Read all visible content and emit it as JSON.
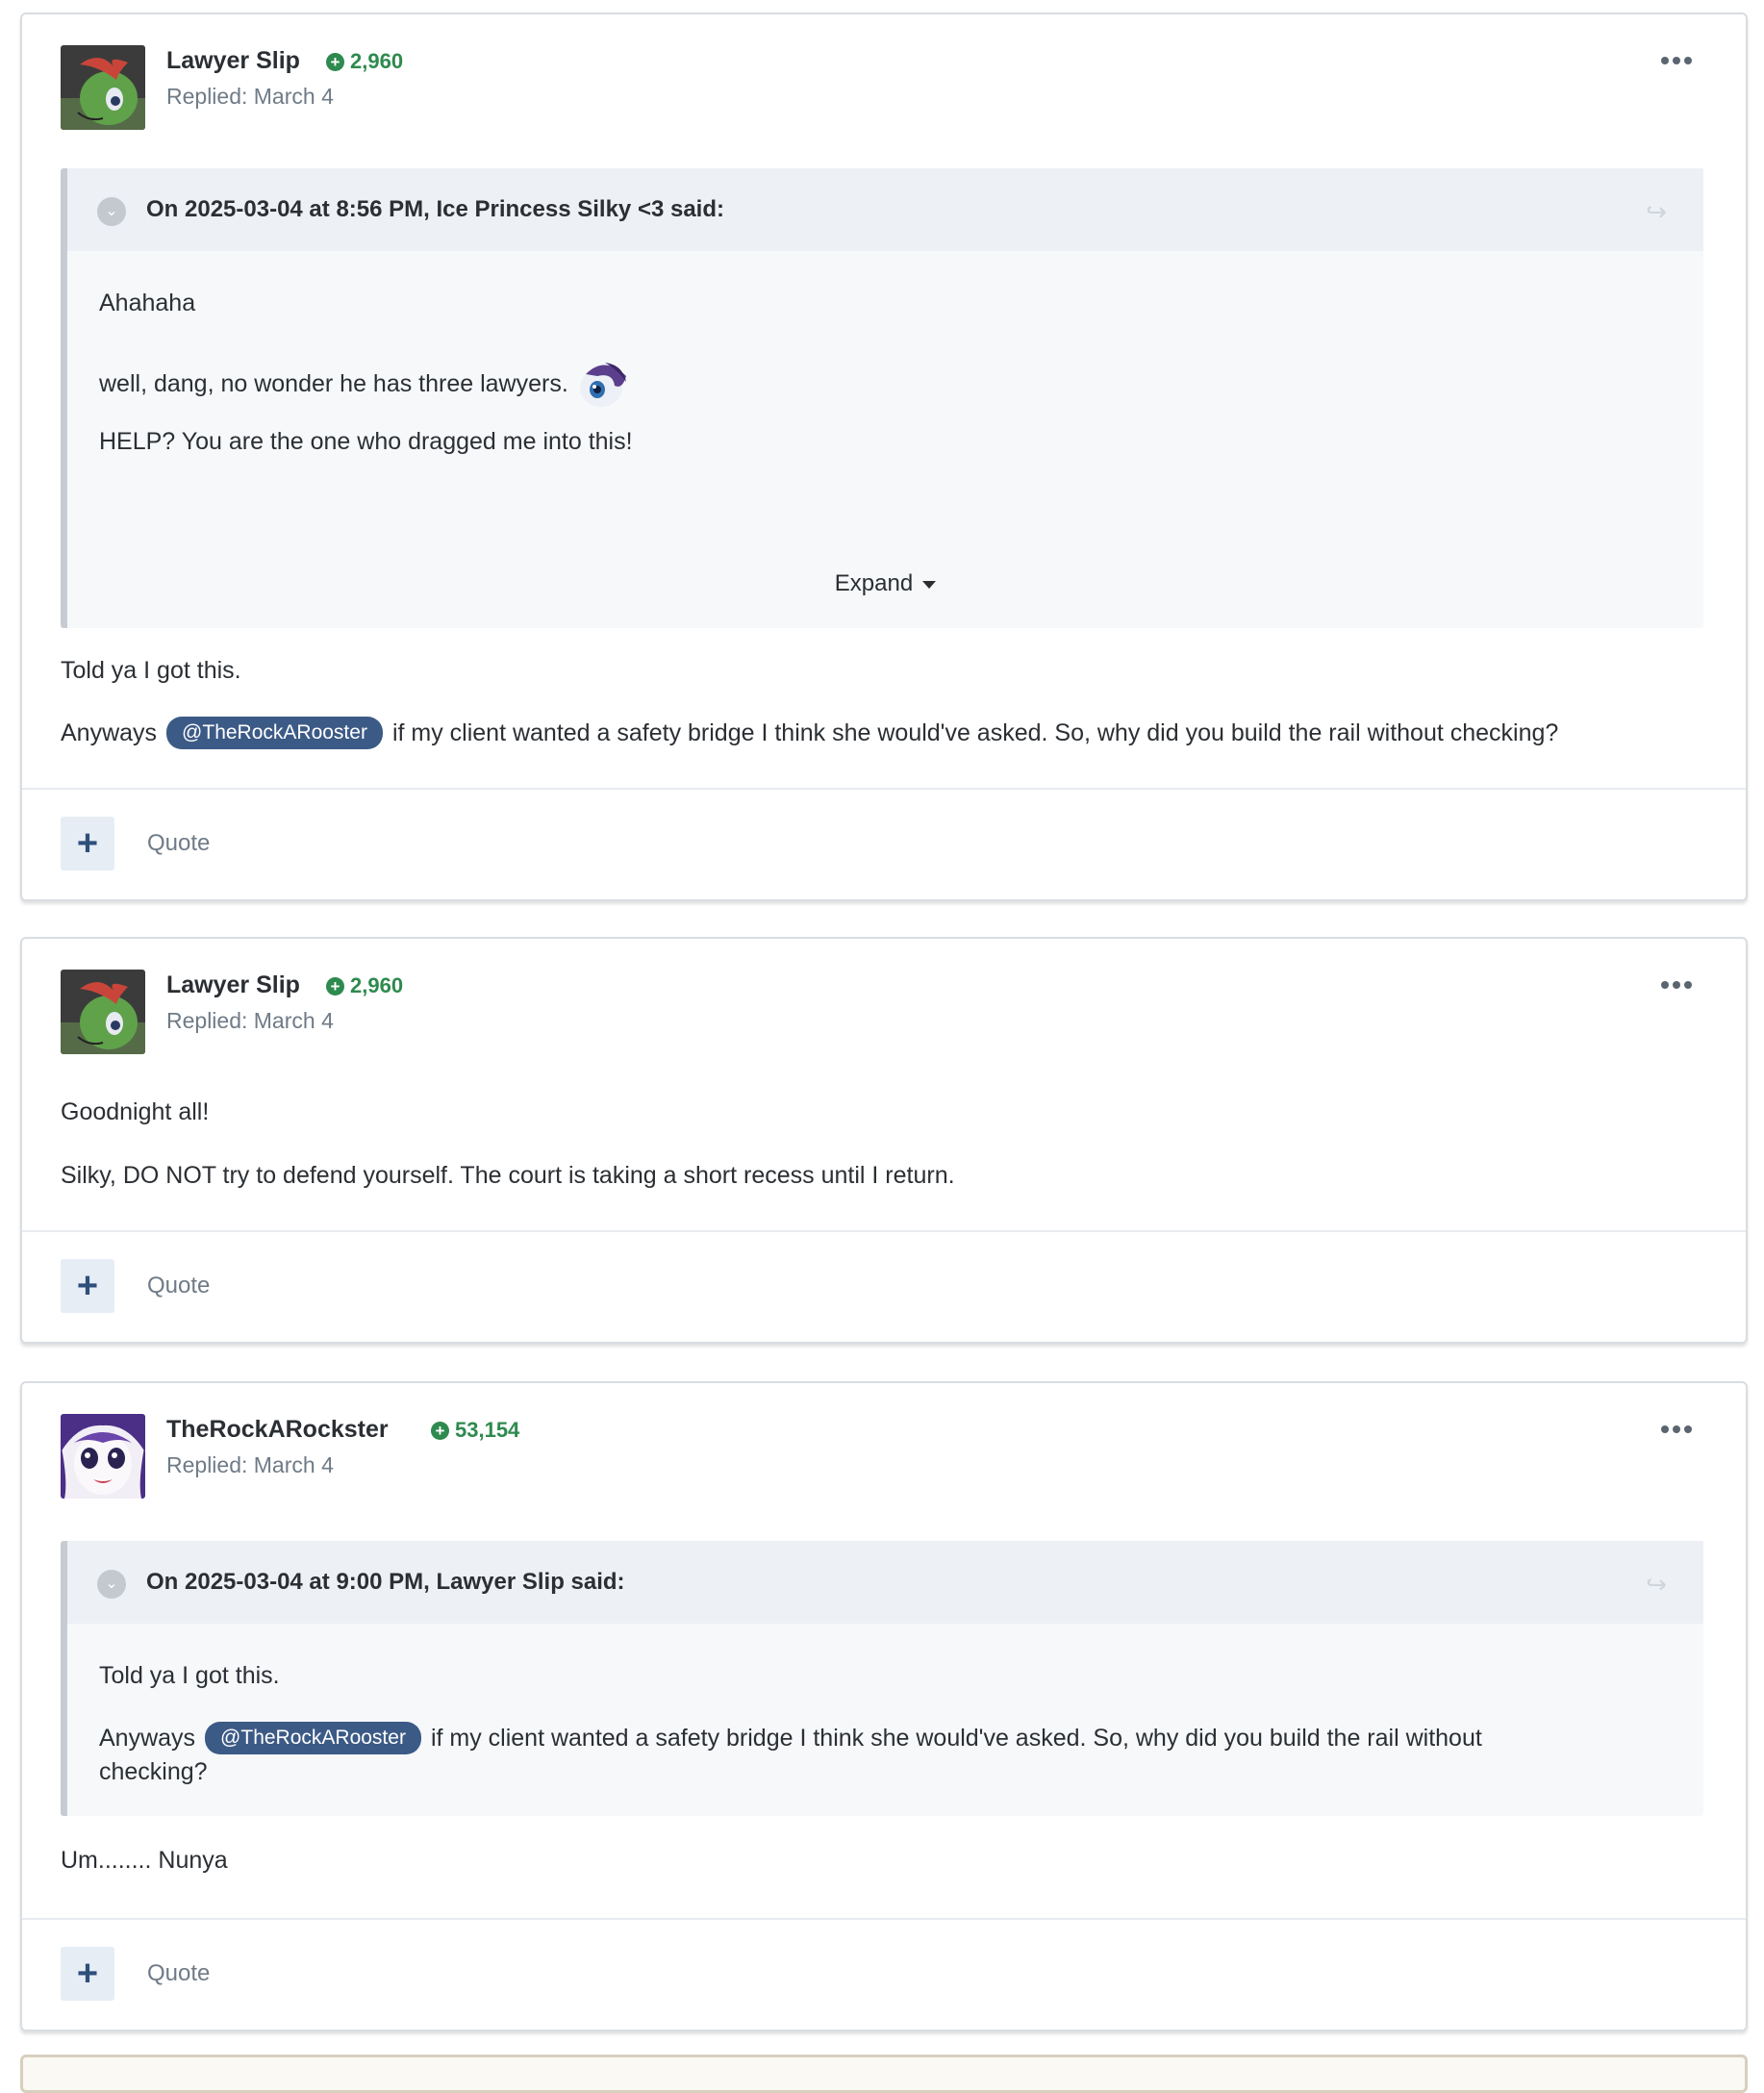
{
  "posts": [
    {
      "username": "Lawyer Slip",
      "reputation": "2,960",
      "replied": "Replied: March 4",
      "quote": {
        "cite": "On 2025-03-04 at 8:56 PM, Ice Princess Silky <3 said:",
        "lines": [
          "Ahahaha",
          "well, dang, no wonder he has three lawyers.",
          "HELP? You are the one who dragged me into this!"
        ],
        "expand_label": "Expand"
      },
      "body": {
        "line1": "Told ya I got this.",
        "line2_prefix": "Anyways",
        "mention": "@TheRockARooster",
        "line2_suffix": "if my client wanted a safety bridge I think she would've asked. So, why did you build the rail without checking?"
      },
      "quote_label": "Quote"
    },
    {
      "username": "Lawyer Slip",
      "reputation": "2,960",
      "replied": "Replied: March 4",
      "body": {
        "line1": "Goodnight all!",
        "line2": "Silky, DO NOT try to defend yourself. The court is taking a short recess until I return."
      },
      "quote_label": "Quote"
    },
    {
      "username": "TheRockARockster",
      "reputation": "53,154",
      "replied": "Replied: March 4",
      "quote": {
        "cite": "On 2025-03-04 at 9:00 PM, Lawyer Slip said:",
        "line1": "Told ya I got this.",
        "line2_prefix": "Anyways",
        "mention": "@TheRockARooster",
        "line2_suffix": "if my client wanted a safety bridge I think she would've asked. So, why did you build the rail without",
        "line3": "checking?"
      },
      "body": {
        "line1": "Um........ Nunya"
      },
      "quote_label": "Quote"
    }
  ],
  "colors": {
    "reputation": "#2e8a4e",
    "mention_bg": "#3c5a86",
    "muted_text": "#6f7b87",
    "quote_header_bg": "#edf0f4"
  },
  "icons": [
    "reputation-plus-icon",
    "more-options-icon",
    "quote-collapse-icon",
    "quote-share-icon",
    "plus-icon",
    "emoji-rarity-icon"
  ]
}
